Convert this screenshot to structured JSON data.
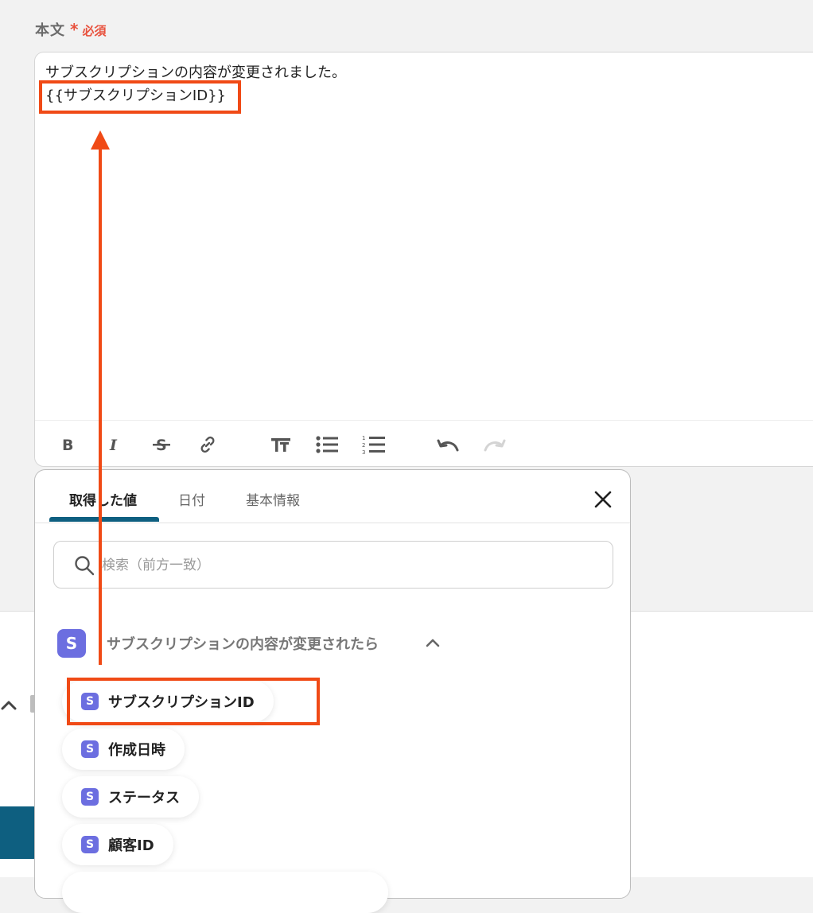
{
  "field": {
    "label": "本文",
    "required_star": "*",
    "required_text": "必須"
  },
  "editor": {
    "lines": [
      "サブスクリプションの内容が変更されました。",
      "{{サブスクリプションID}}"
    ],
    "toolbar": [
      {
        "name": "bold-icon",
        "glyph": "B"
      },
      {
        "name": "italic-icon",
        "glyph": "I"
      },
      {
        "name": "strikethrough-icon",
        "glyph": "S"
      },
      {
        "name": "link-icon",
        "glyph": "link"
      },
      {
        "name": "text-size-icon",
        "glyph": "TT"
      },
      {
        "name": "bullet-list-icon",
        "glyph": "ul"
      },
      {
        "name": "numbered-list-icon",
        "glyph": "ol"
      },
      {
        "name": "undo-icon",
        "glyph": "undo"
      },
      {
        "name": "redo-icon",
        "glyph": "redo"
      }
    ]
  },
  "popover": {
    "tabs": [
      {
        "label": "取得した値",
        "active": true
      },
      {
        "label": "日付",
        "active": false
      },
      {
        "label": "基本情報",
        "active": false
      }
    ],
    "search_placeholder": "検索（前方一致）",
    "group": {
      "badge": "S",
      "title": "サブスクリプションの内容が変更されたら"
    },
    "items": [
      {
        "badge": "S",
        "label": "サブスクリプションID",
        "highlighted": true
      },
      {
        "badge": "S",
        "label": "作成日時"
      },
      {
        "badge": "S",
        "label": "ステータス"
      },
      {
        "badge": "S",
        "label": "顧客ID"
      }
    ]
  },
  "colors": {
    "accent": "#0e5f80",
    "badge": "#6c6ee0",
    "required": "#e8513d",
    "annotation": "#f04a16"
  }
}
